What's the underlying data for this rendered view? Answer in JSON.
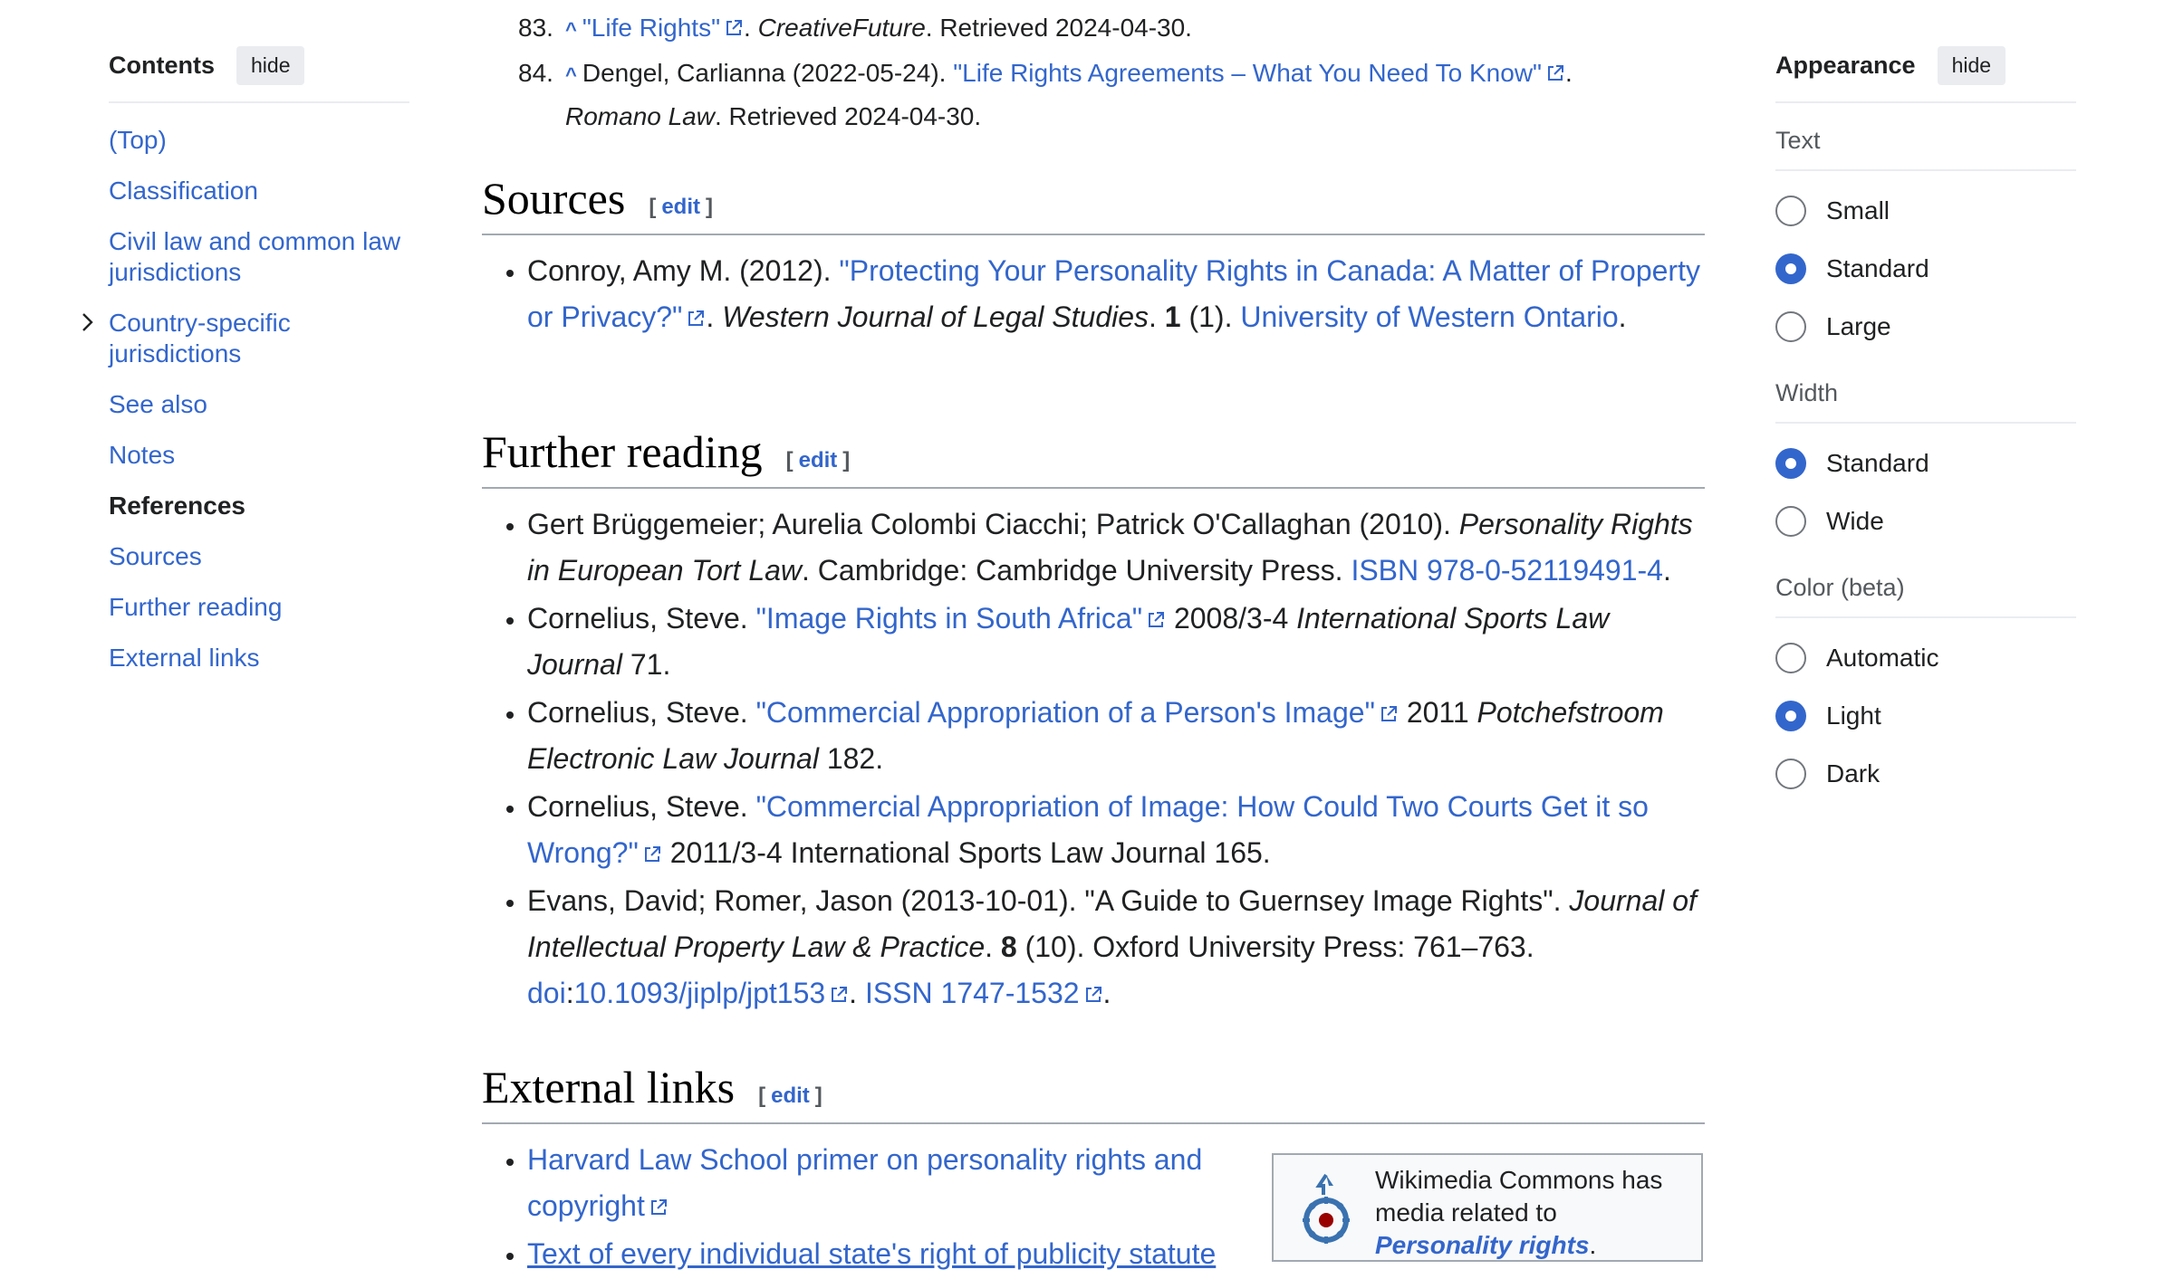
{
  "toc": {
    "title": "Contents",
    "hide_label": "hide",
    "items": [
      {
        "label": "(Top)"
      },
      {
        "label": "Classification"
      },
      {
        "label": "Civil law and common law jurisdictions"
      },
      {
        "label": "Country-specific jurisdictions"
      },
      {
        "label": "See also"
      },
      {
        "label": "Notes"
      },
      {
        "label": "References"
      },
      {
        "label": "Sources"
      },
      {
        "label": "Further reading"
      },
      {
        "label": "External links"
      }
    ]
  },
  "refs": [
    {
      "num": "83.",
      "caret": "^",
      "link": "\"Life Rights\"",
      "pub": "CreativeFuture",
      "after": ". Retrieved 2024-04-30."
    },
    {
      "num": "84.",
      "caret": "^",
      "author": "Dengel, Carlianna (2022-05-24). ",
      "link": "\"Life Rights Agreements – What You Need To Know\"",
      "pub": "Romano Law",
      "after": ". Retrieved 2024-04-30."
    }
  ],
  "edit_label": "edit",
  "sources": {
    "title": "Sources",
    "item": {
      "author": "Conroy, Amy M. (2012). ",
      "link": "\"Protecting Your Personality Rights in Canada: A Matter of Property or Privacy?\"",
      "journal": "Western Journal of Legal Studies",
      "vol": "1",
      "issue": " (1). ",
      "pub_link": "University of Western Ontario",
      "end": "."
    }
  },
  "further": {
    "title": "Further reading",
    "items": {
      "i1": {
        "text": "Gert Brüggemeier; Aurelia Colombi Ciacchi; Patrick O'Callaghan (2010). ",
        "title": "Personality Rights in European Tort Law",
        "pub": ". Cambridge: Cambridge University Press. ",
        "isbn": "ISBN 978-0-52119491-4",
        "end": "."
      },
      "i2": {
        "author": "Cornelius, Steve. ",
        "link": "\"Image Rights in South Africa\"",
        "mid": " 2008/3-4 ",
        "journal": "International Sports Law Journal",
        "end": " 71."
      },
      "i3": {
        "author": "Cornelius, Steve. ",
        "link": "\"Commercial Appropriation of a Person's Image\"",
        "mid": " 2011 ",
        "journal": "Potchefstroom Electronic Law Journal",
        "end": " 182."
      },
      "i4": {
        "author": "Cornelius, Steve. ",
        "link": "\"Commercial Appropriation of Image: How Could Two Courts Get it so Wrong?\"",
        "end": " 2011/3-4 International Sports Law Journal 165."
      },
      "i5": {
        "text": "Evans, David; Romer, Jason (2013-10-01). \"A Guide to Guernsey Image Rights\". ",
        "journal": "Journal of Intellectual Property Law & Practice",
        "sep": ". ",
        "vol": "8",
        "rest": " (10). Oxford University Press: 761–763. ",
        "doi_label": "doi",
        "colon": ":",
        "doi": "10.1093/jiplp/jpt153",
        "dot": ". ",
        "issn": "ISSN 1747-1532",
        "end": "."
      }
    }
  },
  "external": {
    "title": "External links",
    "items": [
      {
        "label": "Harvard Law School primer on personality rights and copyright"
      },
      {
        "label": "Text of every individual state's right of publicity statute"
      }
    ],
    "commons": {
      "text": "Wikimedia Commons has media related to ",
      "link": "Personality rights",
      "end": "."
    }
  },
  "appearance": {
    "title": "Appearance",
    "hide_label": "hide",
    "text_label": "Text",
    "text_options": [
      {
        "label": "Small",
        "checked": false
      },
      {
        "label": "Standard",
        "checked": true
      },
      {
        "label": "Large",
        "checked": false
      }
    ],
    "width_label": "Width",
    "width_options": [
      {
        "label": "Standard",
        "checked": true
      },
      {
        "label": "Wide",
        "checked": false
      }
    ],
    "color_label": "Color (beta)",
    "color_options": [
      {
        "label": "Automatic",
        "checked": false
      },
      {
        "label": "Light",
        "checked": true
      },
      {
        "label": "Dark",
        "checked": false
      }
    ]
  },
  "colors": {
    "link": "#3366cc",
    "text": "#202122",
    "accent": "#3366cc"
  }
}
